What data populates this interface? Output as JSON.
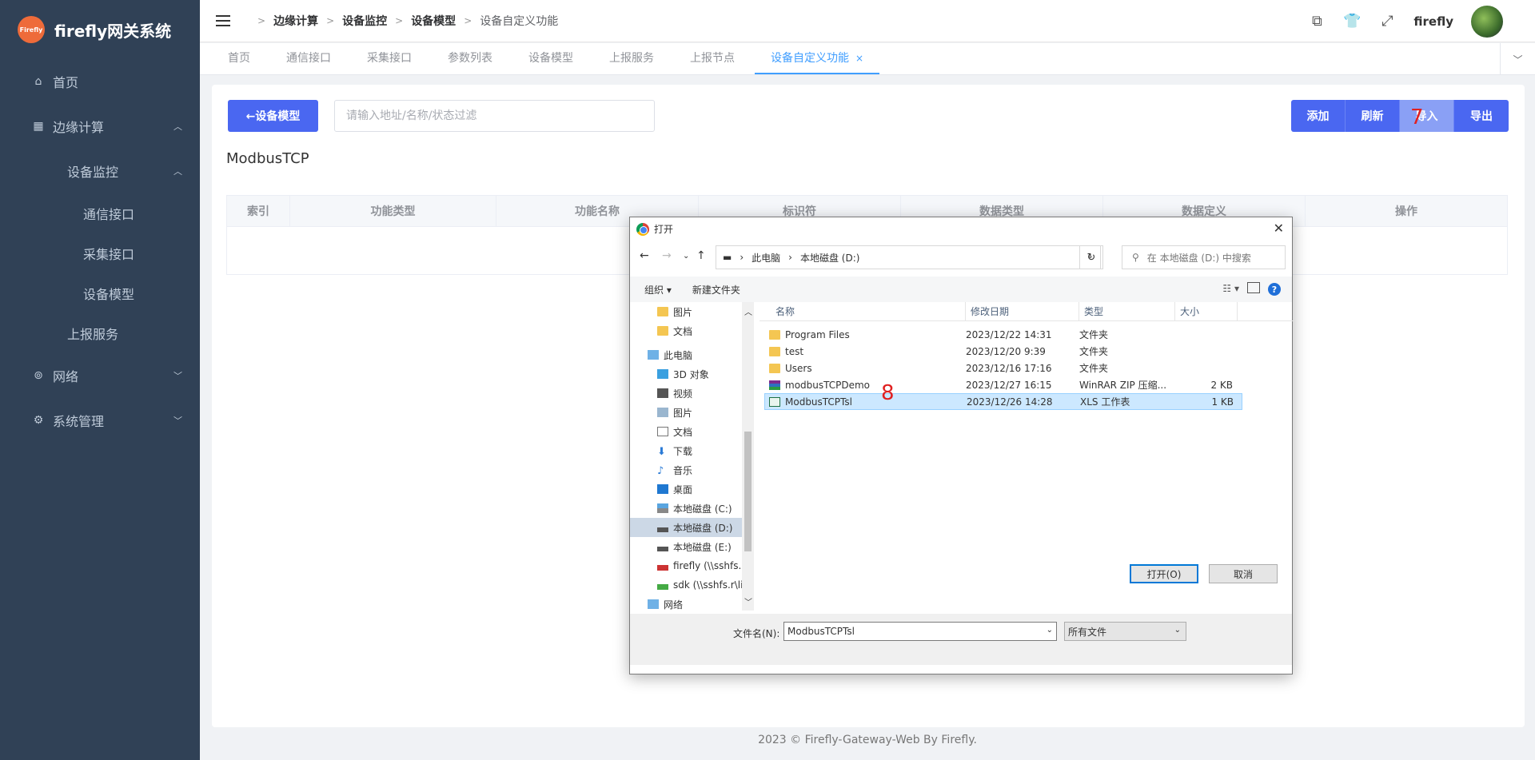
{
  "app": {
    "title": "firefly网关系统",
    "logo_text": "Firefly"
  },
  "sidebar": {
    "items": [
      {
        "label": "首页"
      },
      {
        "label": "边缘计算"
      },
      {
        "label": "设备监控"
      },
      {
        "label": "通信接口"
      },
      {
        "label": "采集接口"
      },
      {
        "label": "设备模型"
      },
      {
        "label": "上报服务"
      },
      {
        "label": "网络"
      },
      {
        "label": "系统管理"
      }
    ]
  },
  "header": {
    "breadcrumb": [
      "边缘计算",
      "设备监控",
      "设备模型",
      "设备自定义功能"
    ],
    "username": "firefly"
  },
  "tabs": [
    {
      "label": "首页"
    },
    {
      "label": "通信接口"
    },
    {
      "label": "采集接口"
    },
    {
      "label": "参数列表"
    },
    {
      "label": "设备模型"
    },
    {
      "label": "上报服务"
    },
    {
      "label": "上报节点"
    },
    {
      "label": "设备自定义功能",
      "close": "×"
    }
  ],
  "main": {
    "back_label": "←设备模型",
    "filter_placeholder": "请输入地址/名称/状态过滤",
    "buttons": {
      "add": "添加",
      "refresh": "刷新",
      "import": "导入",
      "export": "导出"
    },
    "subtitle": "ModbusTCP",
    "columns": [
      "索引",
      "功能类型",
      "功能名称",
      "标识符",
      "数据类型",
      "数据定义",
      "操作"
    ]
  },
  "annotations": {
    "step7": "7",
    "step8": "8"
  },
  "footer": "2023 © Firefly-Gateway-Web By Firefly.",
  "dialog": {
    "title": "打开",
    "address": [
      "此电脑",
      "本地磁盘 (D:)"
    ],
    "search_placeholder": "在 本地磁盘 (D:) 中搜索",
    "toolbar": {
      "organize": "组织 ▾",
      "new_folder": "新建文件夹"
    },
    "nav_items": [
      {
        "label": "图片"
      },
      {
        "label": "文档"
      },
      {
        "label": "此电脑"
      },
      {
        "label": "3D 对象"
      },
      {
        "label": "视频"
      },
      {
        "label": "图片"
      },
      {
        "label": "文档"
      },
      {
        "label": "下载"
      },
      {
        "label": "音乐"
      },
      {
        "label": "桌面"
      },
      {
        "label": "本地磁盘 (C:)"
      },
      {
        "label": "本地磁盘 (D:)"
      },
      {
        "label": "本地磁盘 (E:)"
      },
      {
        "label": "firefly (\\\\sshfs.r"
      },
      {
        "label": "sdk (\\\\sshfs.r\\li"
      },
      {
        "label": "网络"
      }
    ],
    "columns": {
      "name": "名称",
      "date": "修改日期",
      "type": "类型",
      "size": "大小"
    },
    "files": [
      {
        "name": "Program Files",
        "date": "2023/12/22 14:31",
        "type": "文件夹",
        "size": ""
      },
      {
        "name": "test",
        "date": "2023/12/20 9:39",
        "type": "文件夹",
        "size": ""
      },
      {
        "name": "Users",
        "date": "2023/12/16 17:16",
        "type": "文件夹",
        "size": ""
      },
      {
        "name": "modbusTCPDemo",
        "date": "2023/12/27 16:15",
        "type": "WinRAR ZIP 压缩...",
        "size": "2 KB"
      },
      {
        "name": "ModbusTCPTsl",
        "date": "2023/12/26 14:28",
        "type": "XLS 工作表",
        "size": "1 KB"
      }
    ],
    "filename_label": "文件名(N):",
    "filename_value": "ModbusTCPTsl",
    "filetype": "所有文件",
    "open_label": "打开(O)",
    "cancel_label": "取消"
  },
  "colors": {
    "sidebar_bg": "#304156",
    "primary": "#4a67f1",
    "tab_active": "#409eff",
    "annotation": "#e02020"
  }
}
